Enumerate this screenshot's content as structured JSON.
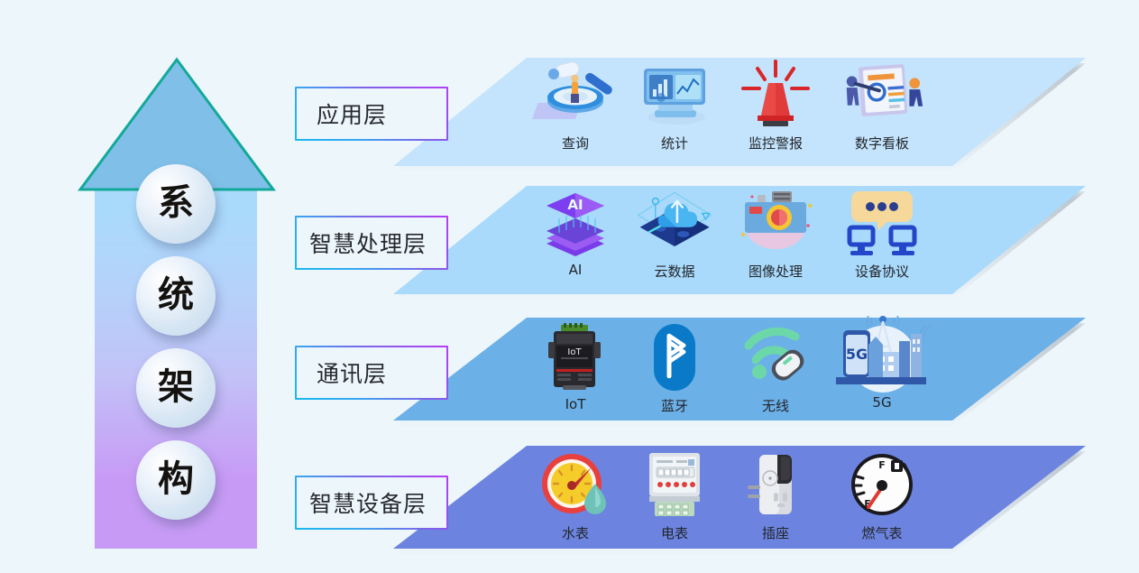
{
  "page": {
    "background_color": "#edf6fb",
    "title_chars": [
      "系",
      "统",
      "架",
      "构"
    ]
  },
  "arrow": {
    "name": "system-architecture-arrow",
    "head_fill": "#80c0e8",
    "head_stroke": "#13a89a",
    "shaft_gradient_top": "#a9dafb",
    "shaft_gradient_bottom": "#c79bf5",
    "circles": [
      {
        "char": "系"
      },
      {
        "char": "统"
      },
      {
        "char": "架"
      },
      {
        "char": "构"
      }
    ]
  },
  "layers": [
    {
      "id": "application",
      "label": "应用层",
      "band_color": "#c3e4fc",
      "items": [
        {
          "label": "查询",
          "icon": "magnifier-search-icon"
        },
        {
          "label": "统计",
          "icon": "statistics-chart-icon"
        },
        {
          "label": "监控警报",
          "icon": "alarm-siren-icon"
        },
        {
          "label": "数字看板",
          "icon": "digital-dashboard-icon"
        }
      ]
    },
    {
      "id": "smart-processing",
      "label": "智慧处理层",
      "band_color": "#a9dafb",
      "items": [
        {
          "label": "AI",
          "icon": "ai-chip-icon"
        },
        {
          "label": "云数据",
          "icon": "cloud-data-icon"
        },
        {
          "label": "图像处理",
          "icon": "camera-image-icon"
        },
        {
          "label": "设备协议",
          "icon": "device-protocol-icon"
        }
      ]
    },
    {
      "id": "communication",
      "label": "通讯层",
      "band_color": "#6cb0e8",
      "items": [
        {
          "label": "IoT",
          "icon": "iot-gateway-icon"
        },
        {
          "label": "蓝牙",
          "icon": "bluetooth-icon"
        },
        {
          "label": "无线",
          "icon": "wireless-wifi-icon"
        },
        {
          "label": "5G",
          "icon": "fiveg-tower-icon"
        }
      ]
    },
    {
      "id": "smart-device",
      "label": "智慧设备层",
      "band_color": "#6c84e0",
      "items": [
        {
          "label": "水表",
          "icon": "water-meter-icon"
        },
        {
          "label": "电表",
          "icon": "electric-meter-icon"
        },
        {
          "label": "插座",
          "icon": "smart-socket-icon"
        },
        {
          "label": "燃气表",
          "icon": "gas-meter-icon"
        }
      ]
    }
  ],
  "colors": {
    "label_border_start": "#18b9ef",
    "label_border_end": "#b43ef2",
    "caption_text": "#22252b"
  }
}
